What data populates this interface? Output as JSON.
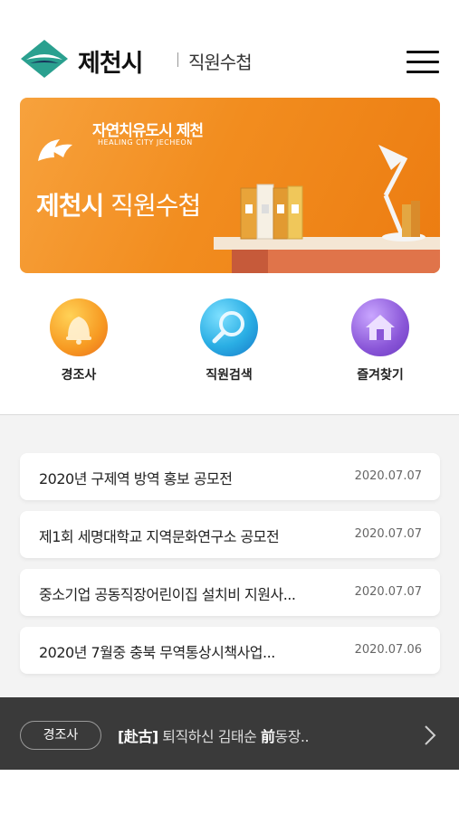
{
  "header": {
    "brand": "제천시",
    "subtitle": "직원수첩"
  },
  "banner": {
    "slogan": "자연치유도시 제천",
    "slogan_en": "HEALING CITY JECHEON",
    "title_bold": "제천시",
    "title_rest": " 직원수첩"
  },
  "quick_menu": [
    {
      "label": "경조사",
      "icon": "bell-icon",
      "color": "#f39a1c"
    },
    {
      "label": "직원검색",
      "icon": "magnifier-icon",
      "color": "#1f9fd6"
    },
    {
      "label": "즐겨찾기",
      "icon": "house-icon",
      "color": "#8a56d8"
    }
  ],
  "notices": [
    {
      "title": "2020년 구제역 방역 홍보 공모전",
      "date": "2020.07.07"
    },
    {
      "title": "제1회 세명대학교 지역문화연구소 공모전",
      "date": "2020.07.07"
    },
    {
      "title": "중소기업 공동직장어린이집 설치비 지원사...",
      "date": "2020.07.07"
    },
    {
      "title": "2020년 7월중 충북 무역통상시책사업...",
      "date": "2020.07.06"
    }
  ],
  "bottom": {
    "badge": "경조사",
    "tag": "[赴古]",
    "text_before": " 퇴직하신 김태순 ",
    "text_bold": "前",
    "text_after": "동장.."
  },
  "colors": {
    "brand_teal": "#2aa08f",
    "banner_orange": "#f28d1f",
    "bottom_bar": "#3a3a3a"
  }
}
